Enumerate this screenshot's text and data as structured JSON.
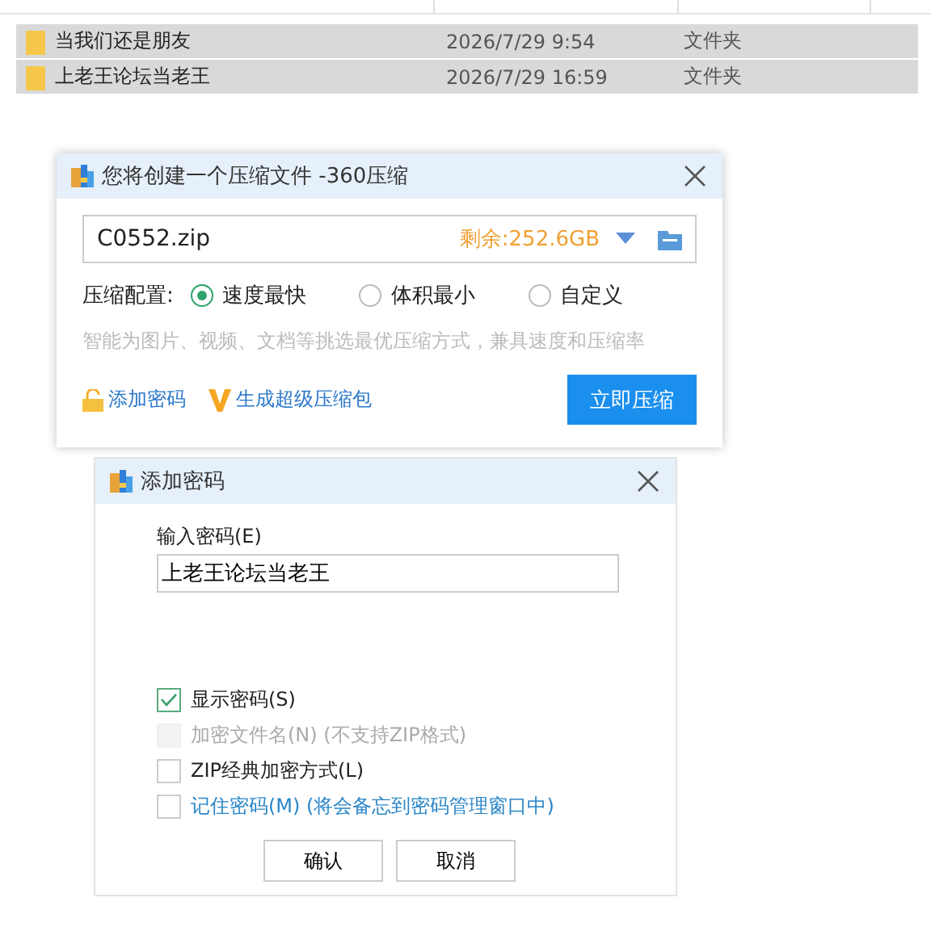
{
  "file_list": {
    "rows": [
      {
        "name": "当我们还是朋友",
        "date": "2026/7/29 9:54",
        "type": "文件夹",
        "selected": true
      },
      {
        "name": "上老王论坛当老王",
        "date": "2026/7/29 16:59",
        "type": "文件夹",
        "selected": true
      }
    ]
  },
  "compress_dialog": {
    "title": "您将创建一个压缩文件 -360压缩",
    "filename": "C0552.zip",
    "free_space": "剩余:252.6GB",
    "config_label": "压缩配置:",
    "options": [
      {
        "label": "速度最快",
        "selected": true
      },
      {
        "label": "体积最小",
        "selected": false
      },
      {
        "label": "自定义",
        "selected": false
      }
    ],
    "hint": "智能为图片、视频、文档等挑选最优压缩方式，兼具速度和压缩率",
    "password_link": "添加密码",
    "super_link": "生成超级压缩包",
    "compress_button": "立即压缩"
  },
  "password_dialog": {
    "title": "添加密码",
    "field_label": "输入密码(E)",
    "value": "上老王论坛当老王",
    "checkboxes": [
      {
        "label": "显示密码(S)",
        "checked": true,
        "disabled": false,
        "kind": "normal"
      },
      {
        "label": "加密文件名(N) (不支持ZIP格式)",
        "checked": false,
        "disabled": true,
        "kind": "normal"
      },
      {
        "label": "ZIP经典加密方式(L)",
        "checked": false,
        "disabled": false,
        "kind": "normal"
      },
      {
        "label": "记住密码(M) (将会备忘到密码管理窗口中)",
        "checked": false,
        "disabled": false,
        "kind": "link"
      }
    ],
    "buttons": [
      "确认",
      "取消"
    ]
  }
}
